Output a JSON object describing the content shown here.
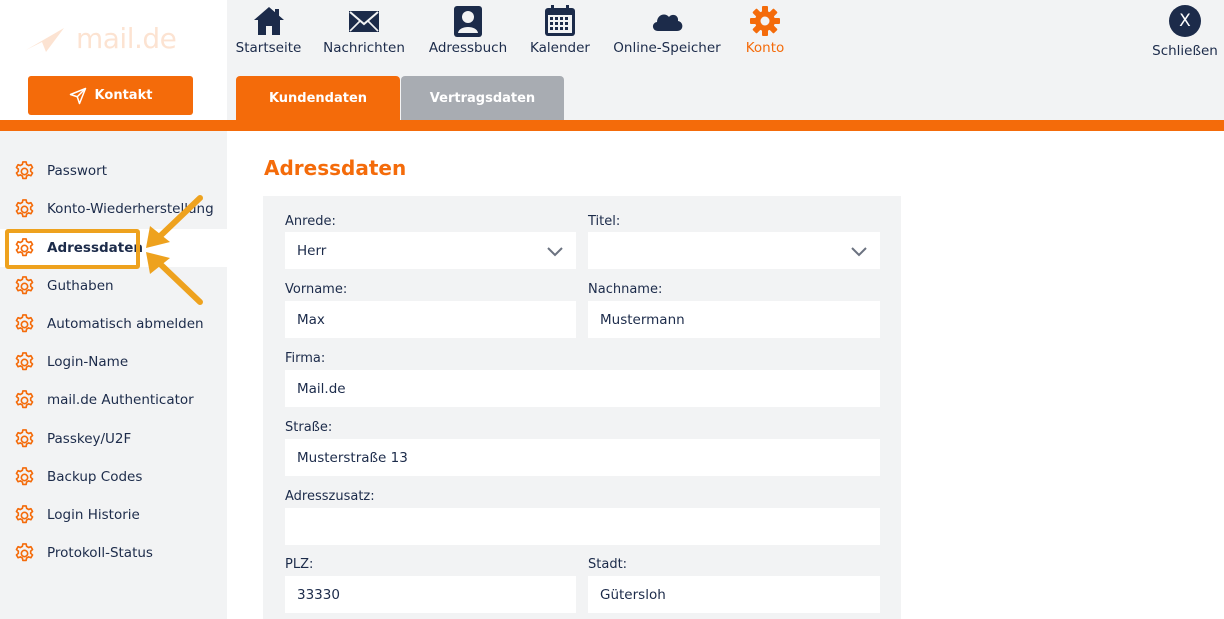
{
  "header": {
    "logo_text": "mail.de",
    "kontakt_label": "Kontakt",
    "nav": [
      {
        "label": "Startseite",
        "icon": "home-icon"
      },
      {
        "label": "Nachrichten",
        "icon": "envelope-icon"
      },
      {
        "label": "Adressbuch",
        "icon": "contact-book-icon"
      },
      {
        "label": "Kalender",
        "icon": "calendar-icon"
      },
      {
        "label": "Online-Speicher",
        "icon": "cloud-icon"
      },
      {
        "label": "Konto",
        "icon": "gear-icon",
        "active": true
      }
    ],
    "close_symbol": "X",
    "close_label": "Schließen"
  },
  "tabs": {
    "kundendaten": "Kundendaten",
    "vertragsdaten": "Vertragsdaten",
    "active": "Kundendaten"
  },
  "sidebar": {
    "items": [
      {
        "label": "Passwort"
      },
      {
        "label": "Konto-Wiederherstellung"
      },
      {
        "label": "Adressdaten",
        "active": true
      },
      {
        "label": "Guthaben"
      },
      {
        "label": "Automatisch abmelden"
      },
      {
        "label": "Login-Name"
      },
      {
        "label": "mail.de Authenticator"
      },
      {
        "label": "Passkey/U2F"
      },
      {
        "label": "Backup Codes"
      },
      {
        "label": "Login Historie"
      },
      {
        "label": "Protokoll-Status"
      }
    ]
  },
  "main": {
    "title": "Adressdaten",
    "form": {
      "anrede": {
        "label": "Anrede:",
        "value": "Herr"
      },
      "titel": {
        "label": "Titel:",
        "value": ""
      },
      "vorname": {
        "label": "Vorname:",
        "value": "Max"
      },
      "nachname": {
        "label": "Nachname:",
        "value": "Mustermann"
      },
      "firma": {
        "label": "Firma:",
        "value": "Mail.de"
      },
      "strasse": {
        "label": "Straße:",
        "value": "Musterstraße 13"
      },
      "adresszusatz": {
        "label": "Adresszusatz:",
        "value": ""
      },
      "plz": {
        "label": "PLZ:",
        "value": "33330"
      },
      "stadt": {
        "label": "Stadt:",
        "value": "Gütersloh"
      }
    }
  },
  "colors": {
    "accent": "#f46b0a",
    "navy": "#1c2b4a",
    "highlight": "#eea21e",
    "panel": "#f2f3f4",
    "inactive_tab": "#a8acb2"
  }
}
